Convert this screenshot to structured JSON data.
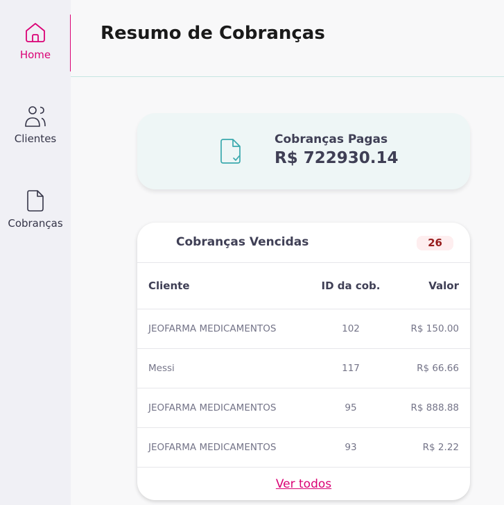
{
  "sidebar": {
    "items": [
      {
        "label": "Home",
        "icon": "home-icon",
        "active": true
      },
      {
        "label": "Clientes",
        "icon": "users-icon",
        "active": false
      },
      {
        "label": "Cobranças",
        "icon": "document-icon",
        "active": false
      }
    ]
  },
  "header": {
    "title": "Resumo de Cobranças"
  },
  "paid_summary": {
    "title": "Cobranças Pagas",
    "value": "R$ 722930.14",
    "icon": "document-check-icon"
  },
  "overdue": {
    "title": "Cobranças Vencidas",
    "count": "26",
    "columns": [
      "Cliente",
      "ID da cob.",
      "Valor"
    ],
    "rows": [
      {
        "client": "JEOFARMA MEDICAMENTOS",
        "id": "102",
        "value": "R$ 150.00"
      },
      {
        "client": "Messi",
        "id": "117",
        "value": "R$ 66.66"
      },
      {
        "client": "JEOFARMA MEDICAMENTOS",
        "id": "95",
        "value": "R$ 888.88"
      },
      {
        "client": "JEOFARMA MEDICAMENTOS",
        "id": "93",
        "value": "R$ 2.22"
      }
    ],
    "see_all_label": "Ver todos"
  },
  "colors": {
    "accent": "#da0175",
    "teal_icon": "#3aa9ad",
    "badge_bg": "#feeeef",
    "badge_text": "#971d1d"
  }
}
